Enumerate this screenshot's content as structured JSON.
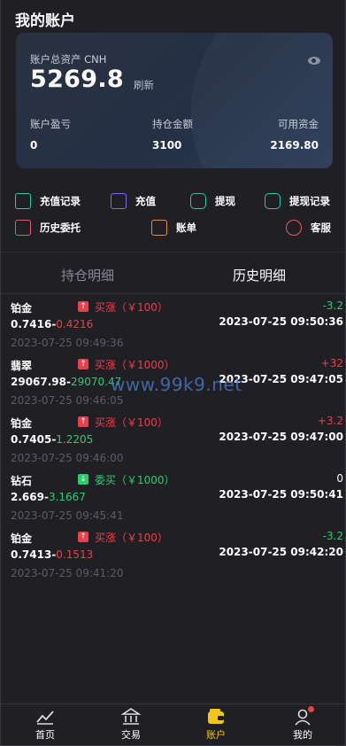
{
  "header": {
    "title": "我的账户"
  },
  "card": {
    "total_label": "账户总资产 CNH",
    "total_value": "5269.8",
    "refresh": "刷新",
    "stats": [
      {
        "label": "账户盈亏",
        "value": "0"
      },
      {
        "label": "持仓金额",
        "value": "3100"
      },
      {
        "label": "可用资金",
        "value": "2169.80"
      }
    ]
  },
  "actions": [
    {
      "label": "充值记录",
      "icon": "recharge-record-icon",
      "color": "#2ec8a6"
    },
    {
      "label": "充值",
      "icon": "recharge-icon",
      "color": "#7b6ee8"
    },
    {
      "label": "提现",
      "icon": "withdraw-icon",
      "color": "#2ec8a6"
    },
    {
      "label": "提现记录",
      "icon": "withdraw-record-icon",
      "color": "#2ec8a6"
    },
    {
      "label": "历史委托",
      "icon": "history-order-icon",
      "color": "#e85a6a"
    },
    {
      "label": "账单",
      "icon": "bill-icon",
      "color": "#e88a3a"
    },
    {
      "label": "客服",
      "icon": "customer-service-icon",
      "color": "#e85a6a"
    }
  ],
  "tabs": [
    {
      "label": "持仓明细",
      "active": false
    },
    {
      "label": "历史明细",
      "active": true
    }
  ],
  "records": [
    {
      "name": "铂金",
      "open": "0.7416",
      "close": "0.4216",
      "dir": "买涨（￥100）",
      "pl": "-3.2",
      "time": "2023-07-25 09:50:36",
      "date": "2023-07-25 09:49:36"
    },
    {
      "name": "翡翠",
      "open": "29067.98",
      "close": "29070.47",
      "dir": "买涨（￥1000）",
      "pl": "+32",
      "time": "2023-07-25 09:47:05",
      "date": "2023-07-25 09:46:05"
    },
    {
      "name": "铂金",
      "open": "0.7405",
      "close": "1.2205",
      "dir": "买涨（￥100）",
      "pl": "+3.2",
      "time": "2023-07-25 09:47:00",
      "date": "2023-07-25 09:46:00"
    },
    {
      "name": "钻石",
      "open": "2.669",
      "close": "3.1667",
      "dir": "委买（￥1000）",
      "pl": "0",
      "time": "2023-07-25 09:50:41",
      "date": "2023-07-25 09:45:41"
    },
    {
      "name": "铂金",
      "open": "0.7413",
      "close": "0.1513",
      "dir": "买涨（￥100）",
      "pl": "-3.2",
      "time": "2023-07-25 09:42:20",
      "date": "2023-07-25 09:41:20"
    }
  ],
  "watermark": "www.99k9.net",
  "nav": [
    {
      "label": "首页",
      "icon": "home-chart-icon"
    },
    {
      "label": "交易",
      "icon": "bank-icon"
    },
    {
      "label": "账户",
      "icon": "wallet-icon",
      "active": true
    },
    {
      "label": "我的",
      "icon": "profile-icon"
    }
  ],
  "colors": {
    "red": "#e8414d",
    "green": "#2ecb71",
    "active": "#f5c518"
  }
}
